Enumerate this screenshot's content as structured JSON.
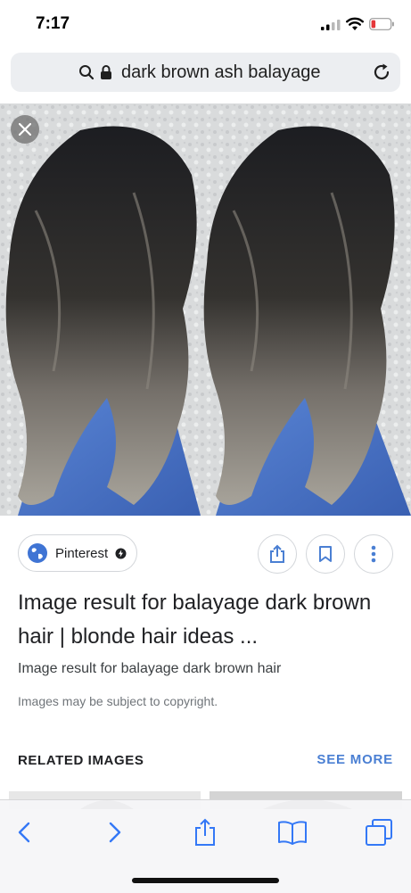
{
  "status_bar": {
    "time": "7:17"
  },
  "address_bar": {
    "query": "dark brown ash balayage",
    "icons": [
      "search-icon",
      "lock-icon",
      "reload-icon"
    ]
  },
  "viewer": {
    "close_icon": "close-icon"
  },
  "source": {
    "name": "Pinterest",
    "icons": [
      "globe-icon",
      "bolt-icon"
    ]
  },
  "actions": {
    "icons": [
      "share-icon",
      "bookmark-icon",
      "more-vert-icon"
    ]
  },
  "result": {
    "title": "Image result for balayage dark brown hair | blonde hair ideas ...",
    "subtitle": "Image result for balayage dark brown hair",
    "copyright": "Images may be subject to copyright."
  },
  "related": {
    "heading": "RELATED IMAGES",
    "see_more": "SEE MORE"
  },
  "toolbar": {
    "icons": [
      "back-icon",
      "forward-icon",
      "share-icon",
      "bookmarks-icon",
      "tabs-icon"
    ]
  },
  "colors": {
    "accent": "#4a7fd3",
    "icon_blue": "#3478f6",
    "battery_low": "#e5383b"
  }
}
